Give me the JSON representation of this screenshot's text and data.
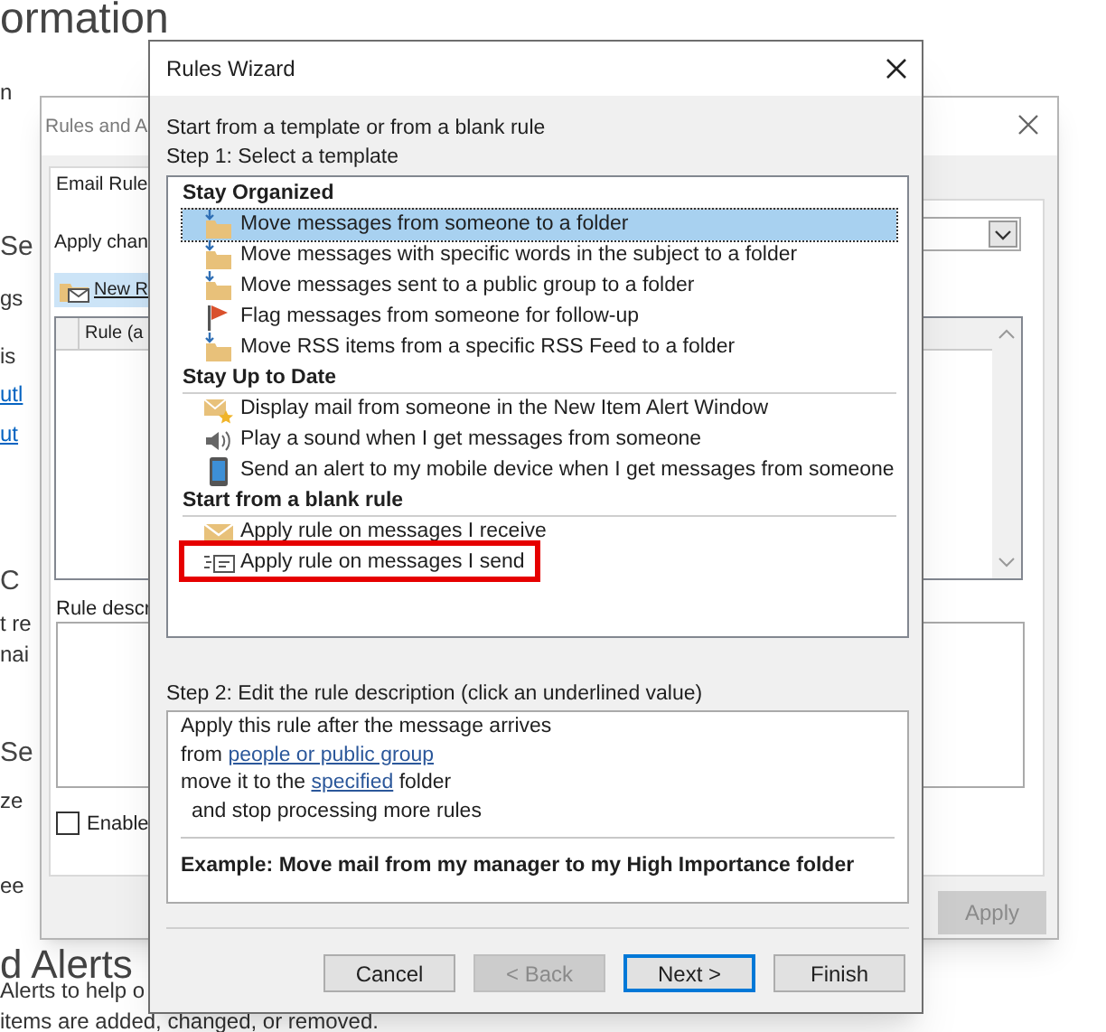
{
  "background_page": {
    "heading": "ormation",
    "fragments": [
      {
        "text": "n",
        "kind": "text"
      },
      {
        "text": "Se",
        "kind": "heading"
      },
      {
        "text": "gs",
        "kind": "text"
      },
      {
        "text": "is",
        "kind": "text"
      },
      {
        "text": "utl",
        "kind": "link"
      },
      {
        "text": "ut",
        "kind": "link"
      },
      {
        "text": "C",
        "kind": "heading"
      },
      {
        "text": "t re",
        "kind": "text"
      },
      {
        "text": "nai",
        "kind": "text"
      },
      {
        "text": "Se",
        "kind": "heading"
      },
      {
        "text": "ze",
        "kind": "text"
      },
      {
        "text": "ee",
        "kind": "text"
      },
      {
        "text": "d Alerts",
        "kind": "heading"
      },
      {
        "text": "Alerts to help o",
        "kind": "text"
      },
      {
        "text": "items are added, changed, or removed.",
        "kind": "text"
      }
    ]
  },
  "rules_and_alerts": {
    "title": "Rules and A",
    "tab": "Email Rule",
    "apply_label": "Apply chan",
    "new_rule_button": "New R",
    "column": "Rule (a",
    "description_label": "Rule descr",
    "enable_checkbox": {
      "label": "Enable",
      "checked": false
    },
    "apply_button": {
      "label": "Apply",
      "disabled": true
    }
  },
  "wizard": {
    "title": "Rules Wizard",
    "intro": "Start from a template or from a blank rule",
    "step1": "Step 1: Select a template",
    "groups": [
      {
        "title": "Stay Organized",
        "items": [
          {
            "label": "Move messages from someone to a folder",
            "kind": "move",
            "selected": true,
            "highlighted": false
          },
          {
            "label": "Move messages with specific words in the subject to a folder",
            "kind": "move",
            "selected": false,
            "highlighted": false
          },
          {
            "label": "Move messages sent to a public group to a folder",
            "kind": "move",
            "selected": false,
            "highlighted": false
          },
          {
            "label": "Flag messages from someone for follow-up",
            "kind": "flag",
            "selected": false,
            "highlighted": false
          },
          {
            "label": "Move RSS items from a specific RSS Feed to a folder",
            "kind": "move",
            "selected": false,
            "highlighted": false
          }
        ]
      },
      {
        "title": "Stay Up to Date",
        "items": [
          {
            "label": "Display mail from someone in the New Item Alert Window",
            "kind": "alert",
            "selected": false,
            "highlighted": false
          },
          {
            "label": "Play a sound when I get messages from someone",
            "kind": "sound",
            "selected": false,
            "highlighted": false
          },
          {
            "label": "Send an alert to my mobile device when I get messages from someone",
            "kind": "mobile",
            "selected": false,
            "highlighted": false
          }
        ]
      },
      {
        "title": "Start from a blank rule",
        "items": [
          {
            "label": "Apply rule on messages I receive",
            "kind": "receive",
            "selected": false,
            "highlighted": false
          },
          {
            "label": "Apply rule on messages I send",
            "kind": "send",
            "selected": false,
            "highlighted": true
          }
        ]
      }
    ],
    "step2": "Step 2: Edit the rule description (click an underlined value)",
    "description": [
      {
        "indented": false,
        "segments": [
          {
            "text": "Apply this rule after the message arrives",
            "link": false
          }
        ]
      },
      {
        "indented": false,
        "segments": [
          {
            "text": "from ",
            "link": false
          },
          {
            "text": "people or public group",
            "link": true
          }
        ]
      },
      {
        "indented": false,
        "segments": [
          {
            "text": "move it to the ",
            "link": false
          },
          {
            "text": "specified",
            "link": true
          },
          {
            "text": " folder",
            "link": false
          }
        ]
      },
      {
        "indented": true,
        "segments": [
          {
            "text": "and stop processing more rules",
            "link": false
          }
        ]
      }
    ],
    "example": "Example: Move mail from my manager to my High Importance folder",
    "buttons": [
      {
        "label": "Cancel",
        "disabled": false,
        "default": false
      },
      {
        "label": "< Back",
        "disabled": true,
        "default": false
      },
      {
        "label": "Next >",
        "disabled": false,
        "default": true
      },
      {
        "label": "Finish",
        "disabled": false,
        "default": false
      }
    ]
  }
}
